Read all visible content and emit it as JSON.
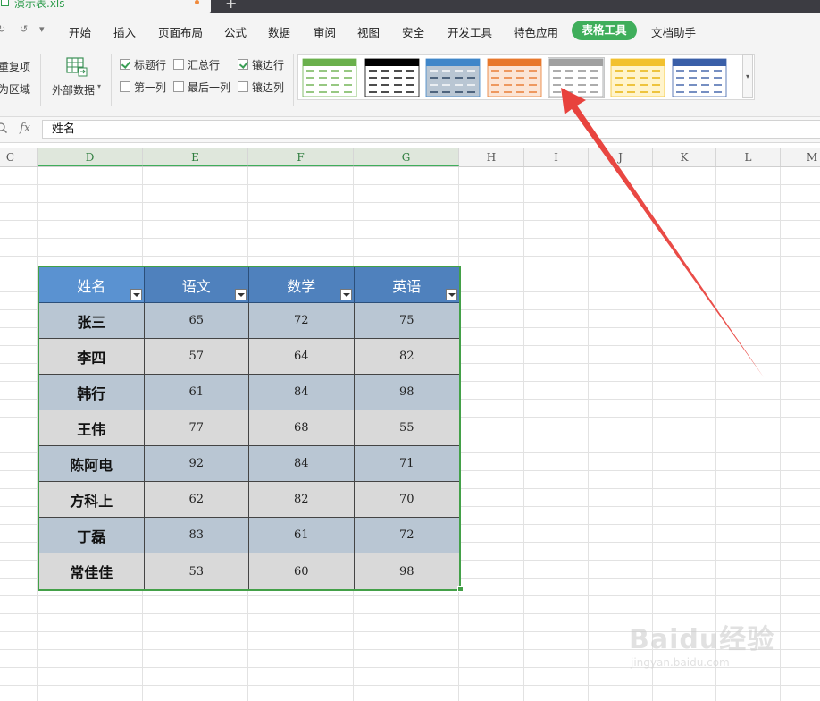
{
  "app": {
    "file_tab": "演示表.xls",
    "new_tab": "+"
  },
  "menu": {
    "items": [
      "开始",
      "插入",
      "页面布局",
      "公式",
      "数据",
      "审阅",
      "视图",
      "安全",
      "开发工具",
      "特色应用"
    ],
    "active": "表格工具",
    "trailing": "文档助手"
  },
  "ribbon": {
    "left_remove_dup": "重复项",
    "left_to_range": "为区域",
    "external_data": "外部数据",
    "options": [
      {
        "label": "标题行",
        "checked": true
      },
      {
        "label": "汇总行",
        "checked": false
      },
      {
        "label": "镶边行",
        "checked": true
      },
      {
        "label": "第一列",
        "checked": false
      },
      {
        "label": "最后一列",
        "checked": false
      },
      {
        "label": "镶边列",
        "checked": false
      }
    ],
    "style_swatches": [
      {
        "name": "green-light",
        "head": "#6ab04c",
        "line": "#6ab04c",
        "bg": "#ffffff",
        "border": "#6ab04c"
      },
      {
        "name": "black",
        "head": "#000000",
        "line": "#000000",
        "bg": "#ffffff",
        "border": "#000000"
      },
      {
        "name": "blue-medium",
        "head": "#3f86c9",
        "line": "#ffffff",
        "bg": "#b9c6d3",
        "border": "#3f86c9"
      },
      {
        "name": "orange",
        "head": "#e8782c",
        "line": "#e8782c",
        "bg": "#fbe5d6",
        "border": "#e8782c"
      },
      {
        "name": "gray",
        "head": "#a0a0a0",
        "line": "#8a8a8a",
        "bg": "#ffffff",
        "border": "#a0a0a0"
      },
      {
        "name": "yellow",
        "head": "#f2c12e",
        "line": "#e6b000",
        "bg": "#fff4cc",
        "border": "#f2c12e"
      },
      {
        "name": "blue-dark",
        "head": "#3a5fa8",
        "line": "#3a5fa8",
        "bg": "#ffffff",
        "border": "#3a5fa8"
      }
    ]
  },
  "formula_bar": {
    "fx": "fx",
    "value": "姓名"
  },
  "columns": [
    "C",
    "D",
    "E",
    "F",
    "G",
    "H",
    "I",
    "J",
    "K",
    "L",
    "M"
  ],
  "table": {
    "headers": [
      "姓名",
      "语文",
      "数学",
      "英语"
    ],
    "rows": [
      [
        "张三",
        "65",
        "72",
        "75"
      ],
      [
        "李四",
        "57",
        "64",
        "82"
      ],
      [
        "韩行",
        "61",
        "84",
        "98"
      ],
      [
        "王伟",
        "77",
        "68",
        "55"
      ],
      [
        "陈阿电",
        "92",
        "84",
        "71"
      ],
      [
        "方科上",
        "62",
        "82",
        "70"
      ],
      [
        "丁磊",
        "83",
        "61",
        "72"
      ],
      [
        "常佳佳",
        "53",
        "60",
        "98"
      ]
    ],
    "band_colors": [
      "#b9c6d3",
      "#d9d9d9"
    ],
    "header_color": "#4f81bd"
  },
  "watermark": {
    "brand": "Baidu经验",
    "url": "jingyan.baidu.com"
  },
  "colors": {
    "accent": "#3fae5b",
    "arrow": "#e8413c"
  }
}
